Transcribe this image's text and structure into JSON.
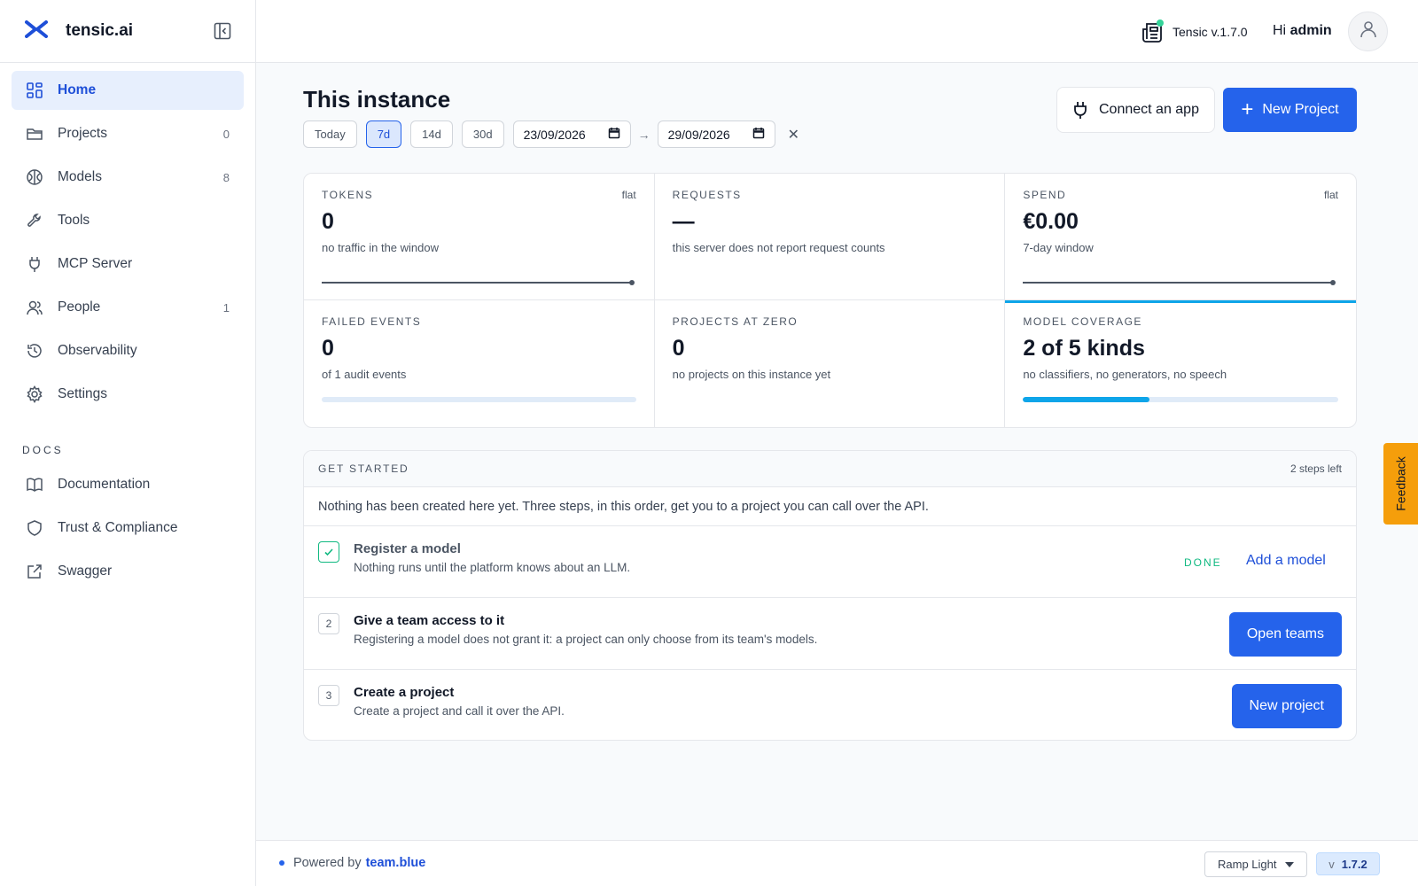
{
  "app": {
    "name": "tensic.ai"
  },
  "sidebar": {
    "items": [
      {
        "label": "Home",
        "icon": "grid-icon",
        "count": ""
      },
      {
        "label": "Projects",
        "icon": "folder-icon",
        "count": "0"
      },
      {
        "label": "Models",
        "icon": "brain-icon",
        "count": "8"
      },
      {
        "label": "Tools",
        "icon": "wrench-icon",
        "count": ""
      },
      {
        "label": "MCP Server",
        "icon": "plug-icon",
        "count": ""
      },
      {
        "label": "People",
        "icon": "users-icon",
        "count": "1"
      },
      {
        "label": "Observability",
        "icon": "history-icon",
        "count": ""
      },
      {
        "label": "Settings",
        "icon": "gear-icon",
        "count": ""
      }
    ],
    "docs_label": "DOCS",
    "docs": [
      {
        "label": "Documentation",
        "icon": "book-icon"
      },
      {
        "label": "Trust & Compliance",
        "icon": "shield-icon"
      },
      {
        "label": "Swagger",
        "icon": "external-link-icon"
      }
    ]
  },
  "topbar": {
    "version": "Tensic v.1.7.0",
    "greeting": "Hi",
    "username": "admin"
  },
  "main": {
    "title": "This instance",
    "ranges": [
      "Today",
      "7d",
      "14d",
      "30d"
    ],
    "active_range": "7d",
    "date_from": "23/09/2026",
    "date_to": "29/09/2026",
    "connect_label": "Connect an app",
    "new_project_label": "New Project"
  },
  "stats": [
    {
      "label": "TOKENS",
      "tag": "flat",
      "value": "0",
      "sub": "no traffic in the window",
      "kind": "spark"
    },
    {
      "label": "REQUESTS",
      "tag": "",
      "value": "—",
      "sub": "this server does not report request counts",
      "kind": "none"
    },
    {
      "label": "SPEND",
      "tag": "flat",
      "value": "€0.00",
      "sub": "7-day window",
      "kind": "spark"
    },
    {
      "label": "FAILED EVENTS",
      "tag": "",
      "value": "0",
      "sub": "of 1 audit events",
      "kind": "bar",
      "fraction": 0
    },
    {
      "label": "PROJECTS AT ZERO",
      "tag": "",
      "value": "0",
      "sub": "no projects on this instance yet",
      "kind": "none"
    },
    {
      "label": "MODEL COVERAGE",
      "tag": "",
      "value": "2 of 5 kinds",
      "sub": "no classifiers, no generators, no speech",
      "kind": "bar",
      "fraction": 0.4
    }
  ],
  "get_started": {
    "label": "GET STARTED",
    "remaining": "2 steps left",
    "intro": "Nothing has been created here yet. Three steps, in this order, get you to a project you can call over the API.",
    "steps": [
      {
        "num": "✓",
        "title": "Register a model",
        "desc": "Nothing runs until the platform knows about an LLM.",
        "status": "DONE",
        "action": "Add a model"
      },
      {
        "num": "2",
        "title": "Give a team access to it",
        "desc": "Registering a model does not grant it: a project can only choose from its team's models.",
        "action": "Open teams"
      },
      {
        "num": "3",
        "title": "Create a project",
        "desc": "Create a project and call it over the API.",
        "action": "New project"
      }
    ]
  },
  "footer": {
    "powered_by": "Powered by",
    "brand": "team.blue",
    "theme": "Ramp Light",
    "version_prefix": "v",
    "version": "1.7.2"
  },
  "feedback_label": "Feedback",
  "colors": {
    "accent": "#2563eb",
    "highlight": "#0ea5e9",
    "success": "#10b981",
    "feedback": "#f59e0b"
  }
}
